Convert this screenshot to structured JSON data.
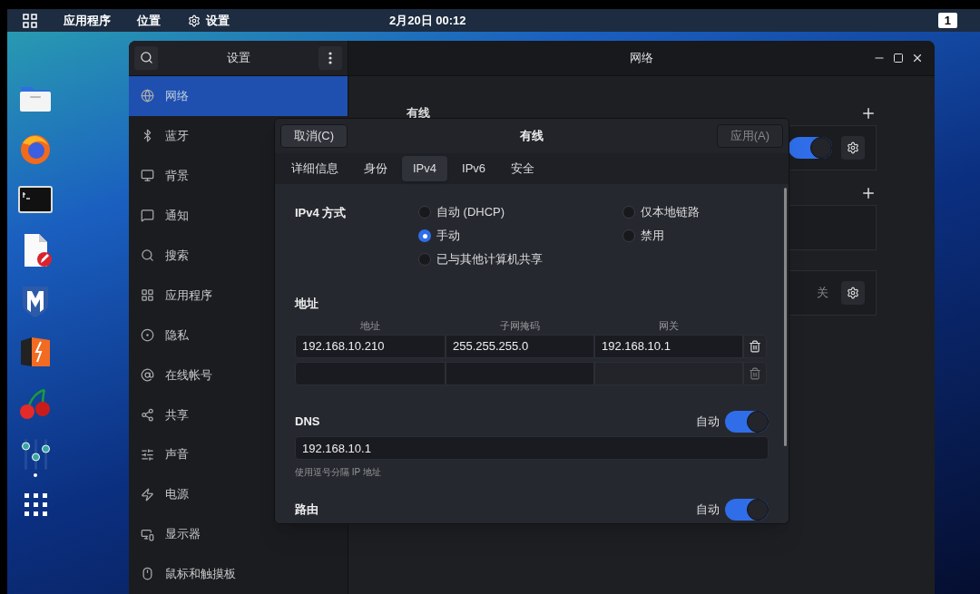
{
  "top_bar": {
    "menus": [
      "应用程序",
      "位置"
    ],
    "settings_menu": "设置",
    "clock": "2月20日  00:12",
    "workspace": "1"
  },
  "dock": [
    {
      "kind": "files",
      "running": false
    },
    {
      "kind": "browser",
      "running": false
    },
    {
      "kind": "terminal",
      "running": false
    },
    {
      "kind": "editor",
      "running": false
    },
    {
      "kind": "shield",
      "running": false
    },
    {
      "kind": "bolt-box",
      "running": false
    },
    {
      "kind": "cherry",
      "running": false
    },
    {
      "kind": "mixer",
      "running": true
    },
    {
      "kind": "app-grid",
      "running": false
    }
  ],
  "settings_window": {
    "sidebar_title": "设置",
    "page_title": "网络",
    "sidebar_items": [
      {
        "label": "网络",
        "kind": "network",
        "selected": true
      },
      {
        "label": "蓝牙",
        "kind": "bluetooth",
        "selected": false
      },
      {
        "label": "背景",
        "kind": "background",
        "selected": false
      },
      {
        "label": "通知",
        "kind": "notifications",
        "selected": false
      },
      {
        "label": "搜索",
        "kind": "search",
        "selected": false
      },
      {
        "label": "应用程序",
        "kind": "applications",
        "selected": false
      },
      {
        "label": "隐私",
        "kind": "privacy",
        "selected": false
      },
      {
        "label": "在线帐号",
        "kind": "accounts",
        "selected": false
      },
      {
        "label": "共享",
        "kind": "sharing",
        "selected": false
      },
      {
        "label": "声音",
        "kind": "sound",
        "selected": false
      },
      {
        "label": "电源",
        "kind": "power",
        "selected": false
      },
      {
        "label": "显示器",
        "kind": "display",
        "selected": false
      },
      {
        "label": "鼠标和触摸板",
        "kind": "mouse",
        "selected": false
      }
    ],
    "network_heading": "有线",
    "cards": [
      {
        "kind": "toggle",
        "on": true
      },
      {
        "kind": "empty"
      },
      {
        "kind": "status",
        "status": "关"
      }
    ]
  },
  "dialog": {
    "title": "有线",
    "cancel": "取消(C)",
    "apply": "应用(A)",
    "apply_disabled": true,
    "tabs": [
      {
        "label": "详细信息",
        "selected": false
      },
      {
        "label": "身份",
        "selected": false
      },
      {
        "label": "IPv4",
        "selected": true
      },
      {
        "label": "IPv6",
        "selected": false
      },
      {
        "label": "安全",
        "selected": false
      }
    ],
    "method": {
      "label": "IPv4 方式",
      "options": [
        {
          "label": "自动 (DHCP)",
          "selected": false
        },
        {
          "label": "仅本地链路",
          "selected": false
        },
        {
          "label": "手动",
          "selected": true
        },
        {
          "label": "禁用",
          "selected": false
        },
        {
          "label": "已与其他计算机共享",
          "selected": false
        }
      ]
    },
    "address": {
      "heading": "地址",
      "columns": [
        "地址",
        "子网掩码",
        "网关"
      ],
      "rows": [
        {
          "values": [
            "192.168.10.210",
            "255.255.255.0",
            "192.168.10.1"
          ]
        }
      ]
    },
    "dns": {
      "heading": "DNS",
      "auto_label": "自动",
      "auto": true,
      "value": "192.168.10.1",
      "hint": "使用逗号分隔 IP 地址"
    },
    "routes": {
      "heading": "路由",
      "auto_label": "自动",
      "auto": true
    }
  }
}
